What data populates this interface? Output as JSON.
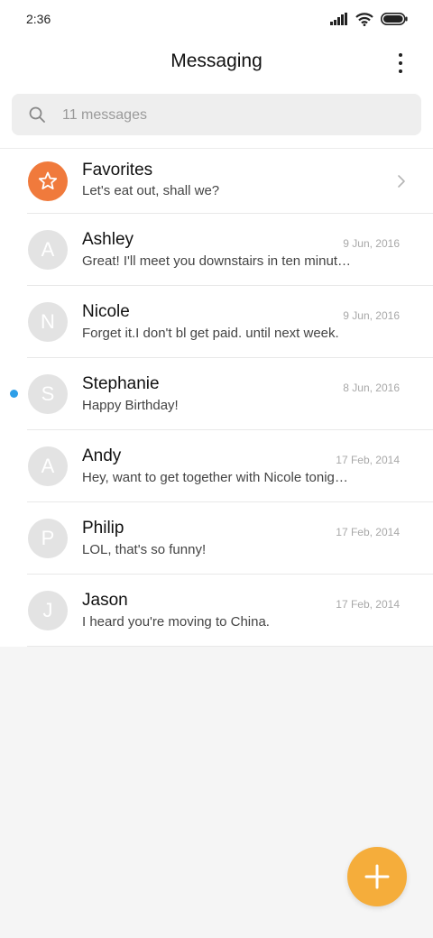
{
  "status_bar": {
    "time": "2:36",
    "icons": [
      "signal-icon",
      "wifi-icon",
      "battery-icon"
    ]
  },
  "header": {
    "title": "Messaging",
    "more_icon": "more-vertical-icon"
  },
  "search": {
    "placeholder": "11 messages",
    "icon": "search-icon"
  },
  "favorites": {
    "name": "Favorites",
    "preview": "Let's eat out, shall we?",
    "icon": "star-icon",
    "chevron": "chevron-right-icon"
  },
  "conversations": [
    {
      "initial": "A",
      "name": "Ashley",
      "date": "9 Jun, 2016",
      "preview": "Great! I'll meet you downstairs in ten minutes.",
      "unread": false
    },
    {
      "initial": "N",
      "name": "Nicole",
      "date": "9 Jun, 2016",
      "preview": "Forget it.I don't bl get paid. until next week.",
      "unread": false
    },
    {
      "initial": "S",
      "name": "Stephanie",
      "date": "8 Jun, 2016",
      "preview": "Happy Birthday!",
      "unread": true
    },
    {
      "initial": "A",
      "name": "Andy",
      "date": "17 Feb, 2014",
      "preview": "Hey, want to get together with Nicole tonight?",
      "unread": false
    },
    {
      "initial": "P",
      "name": "Philip",
      "date": "17 Feb, 2014",
      "preview": "LOL, that's so funny!",
      "unread": false
    },
    {
      "initial": "J",
      "name": "Jason",
      "date": "17 Feb, 2014",
      "preview": "I heard you're moving to China.",
      "unread": false
    }
  ],
  "fab": {
    "icon": "plus-icon",
    "color": "#f5ad3b"
  },
  "colors": {
    "favorites_avatar": "#f07a3c",
    "unread_dot": "#2e9fe8",
    "avatar_gray": "#e3e3e3"
  }
}
